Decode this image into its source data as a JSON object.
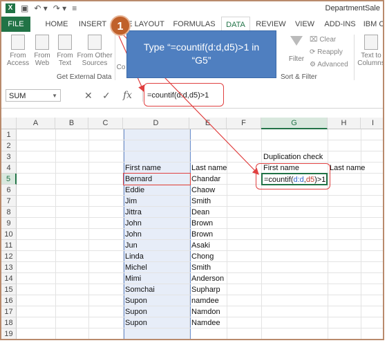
{
  "title_bar": {
    "app_icon": "excel-icon",
    "window_title": "DepartmentSale"
  },
  "tabs": [
    {
      "label": "FILE"
    },
    {
      "label": "HOME"
    },
    {
      "label": "INSERT"
    },
    {
      "label": "E LAYOUT"
    },
    {
      "label": "FORMULAS"
    },
    {
      "label": "DATA"
    },
    {
      "label": "REVIEW"
    },
    {
      "label": "VIEW"
    },
    {
      "label": "ADD-INS"
    },
    {
      "label": "IBM C"
    }
  ],
  "ribbon": {
    "from_access_1": "From",
    "from_access_2": "Access",
    "from_web_1": "From",
    "from_web_2": "Web",
    "from_text_1": "From",
    "from_text_2": "Text",
    "from_other_1": "From Other",
    "from_other_2": "Sources",
    "get_external_data": "Get External Data",
    "connections_fragment": "Co",
    "filter": "Filter",
    "clear": "Clear",
    "reapply": "Reapply",
    "advanced": "Advanced",
    "sort_filter": "Sort & Filter",
    "text_to_1": "Text to",
    "text_to_2": "Columns"
  },
  "formula_bar": {
    "name_box": "SUM",
    "cancel": "✕",
    "enter": "✓",
    "fx": "fx",
    "formula": "=countif(d:d,d5)>1"
  },
  "columns": [
    "A",
    "B",
    "C",
    "D",
    "E",
    "F",
    "G",
    "H",
    "I"
  ],
  "rows": [
    "1",
    "2",
    "3",
    "4",
    "5",
    "6",
    "7",
    "8",
    "9",
    "10",
    "11",
    "12",
    "13",
    "14",
    "15",
    "16",
    "17",
    "18",
    "19"
  ],
  "cells": {
    "G3": "Duplication check",
    "D4": "First name",
    "E4": "Last name",
    "G4": "First name",
    "H4": "Last name",
    "G5_parts": [
      "=countif(",
      "d:d",
      ",",
      "d5",
      ")>1"
    ]
  },
  "records": [
    {
      "first": "Bernard",
      "last": "Chandar"
    },
    {
      "first": "Eddie",
      "last": "Chaow"
    },
    {
      "first": "Jim",
      "last": "Smith"
    },
    {
      "first": "Jittra",
      "last": "Dean"
    },
    {
      "first": "John",
      "last": "Brown"
    },
    {
      "first": "John",
      "last": "Brown"
    },
    {
      "first": "Jun",
      "last": "Asaki"
    },
    {
      "first": "Linda",
      "last": "Chong"
    },
    {
      "first": "Michel",
      "last": "Smith"
    },
    {
      "first": "Mimi",
      "last": "Anderson"
    },
    {
      "first": "Somchai",
      "last": "Supharp"
    },
    {
      "first": "Supon",
      "last": "namdee"
    },
    {
      "first": "Supon",
      "last": "Namdon"
    },
    {
      "first": "Supon",
      "last": "Namdee"
    }
  ],
  "annotation": {
    "step": "1",
    "callout_line1": "Type “=countif(d:d,d5)>1 in",
    "callout_line2": "“G5”"
  },
  "colors": {
    "excel_green": "#217346",
    "callout_blue": "#4f7fc0",
    "badge_orange": "#c0612b",
    "highlight_red": "#e04040"
  }
}
